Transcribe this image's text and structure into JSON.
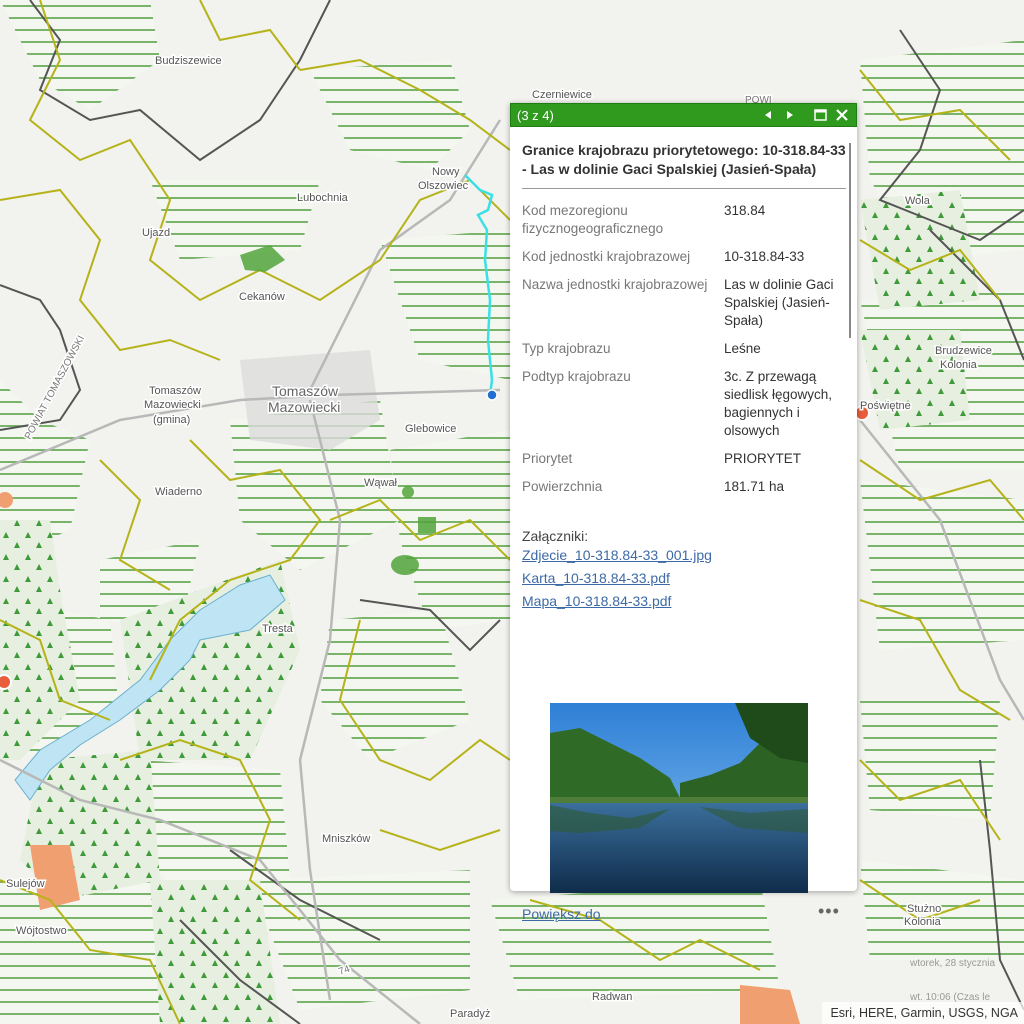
{
  "map": {
    "places": [
      {
        "name": "Budziszewice",
        "cls": "place"
      },
      {
        "name": "Czerniewice",
        "cls": "place"
      },
      {
        "name": "Nowy",
        "cls": "place"
      },
      {
        "name": "Olszowiec",
        "cls": "place"
      },
      {
        "name": "Lubochnia",
        "cls": "place"
      },
      {
        "name": "Ujazd",
        "cls": "place"
      },
      {
        "name": "Cekanów",
        "cls": "place"
      },
      {
        "name": "Tomaszów",
        "cls": "place big"
      },
      {
        "name": "Mazowiecki",
        "cls": "place big"
      },
      {
        "name": "Tomaszów",
        "cls": "place"
      },
      {
        "name": "Mazowiecki",
        "cls": "place"
      },
      {
        "name": "(gmina)",
        "cls": "place"
      },
      {
        "name": "Glebowice",
        "cls": "place"
      },
      {
        "name": "Wąwał",
        "cls": "place"
      },
      {
        "name": "Wiaderno",
        "cls": "place"
      },
      {
        "name": "Tresta",
        "cls": "place"
      },
      {
        "name": "Mniszków",
        "cls": "place"
      },
      {
        "name": "Sulejów",
        "cls": "place"
      },
      {
        "name": "Wójtostwo",
        "cls": "place"
      },
      {
        "name": "Radwan",
        "cls": "place"
      },
      {
        "name": "Paradyż",
        "cls": "place"
      },
      {
        "name": "Stużno",
        "cls": "place"
      },
      {
        "name": "Kolonia",
        "cls": "place"
      },
      {
        "name": "Brudzewice",
        "cls": "place"
      },
      {
        "name": "Kolonia",
        "cls": "place"
      },
      {
        "name": "Poświętne",
        "cls": "place"
      },
      {
        "name": "Wola",
        "cls": "place"
      },
      {
        "name": "POWIAT TOMASZOWSKI",
        "cls": "place road"
      },
      {
        "name": "POWI",
        "cls": "place road"
      },
      {
        "name": "74",
        "cls": "place road"
      }
    ]
  },
  "popup": {
    "counter": "(3 z 4)",
    "title": "Granice krajobrazu priorytetowego: 10-318.84-33 - Las w dolinie Gaci Spalskiej (Jasień-Spała)",
    "attributes": [
      {
        "key": "Kod mezoregionu fizycznogeograficznego",
        "value": "318.84"
      },
      {
        "key": "Kod jednostki krajobrazowej",
        "value": "10-318.84-33"
      },
      {
        "key": "Nazwa jednostki krajobrazowej",
        "value": "Las w dolinie Gaci Spalskiej (Jasień-Spała)"
      },
      {
        "key": "Typ krajobrazu",
        "value": "Leśne"
      },
      {
        "key": "Podtyp krajobrazu",
        "value": "3c. Z przewagą siedlisk łęgowych, bagiennych i olsowych"
      },
      {
        "key": "Priorytet",
        "value": "PRIORYTET"
      },
      {
        "key": "Powierzchnia",
        "value": "181.71 ha"
      }
    ],
    "attachments_label": "Załączniki:",
    "attachments": [
      "Zdjecie_10-318.84-33_001.jpg",
      "Karta_10-318.84-33.pdf",
      "Mapa_10-318.84-33.pdf"
    ],
    "zoom_label": "Powiększ do",
    "more_label": "•••",
    "icons": {
      "prev": "triangle-left-icon",
      "next": "triangle-right-icon",
      "maximize": "maximize-icon",
      "close": "close-icon"
    },
    "header_color": "#2f9a1e"
  },
  "footer": {
    "attribution": "Esri, HERE, Garmin, USGS, NGA",
    "time1": "wtorek, 28 stycznia",
    "time2": "wt. 10:06 (Czas le"
  }
}
